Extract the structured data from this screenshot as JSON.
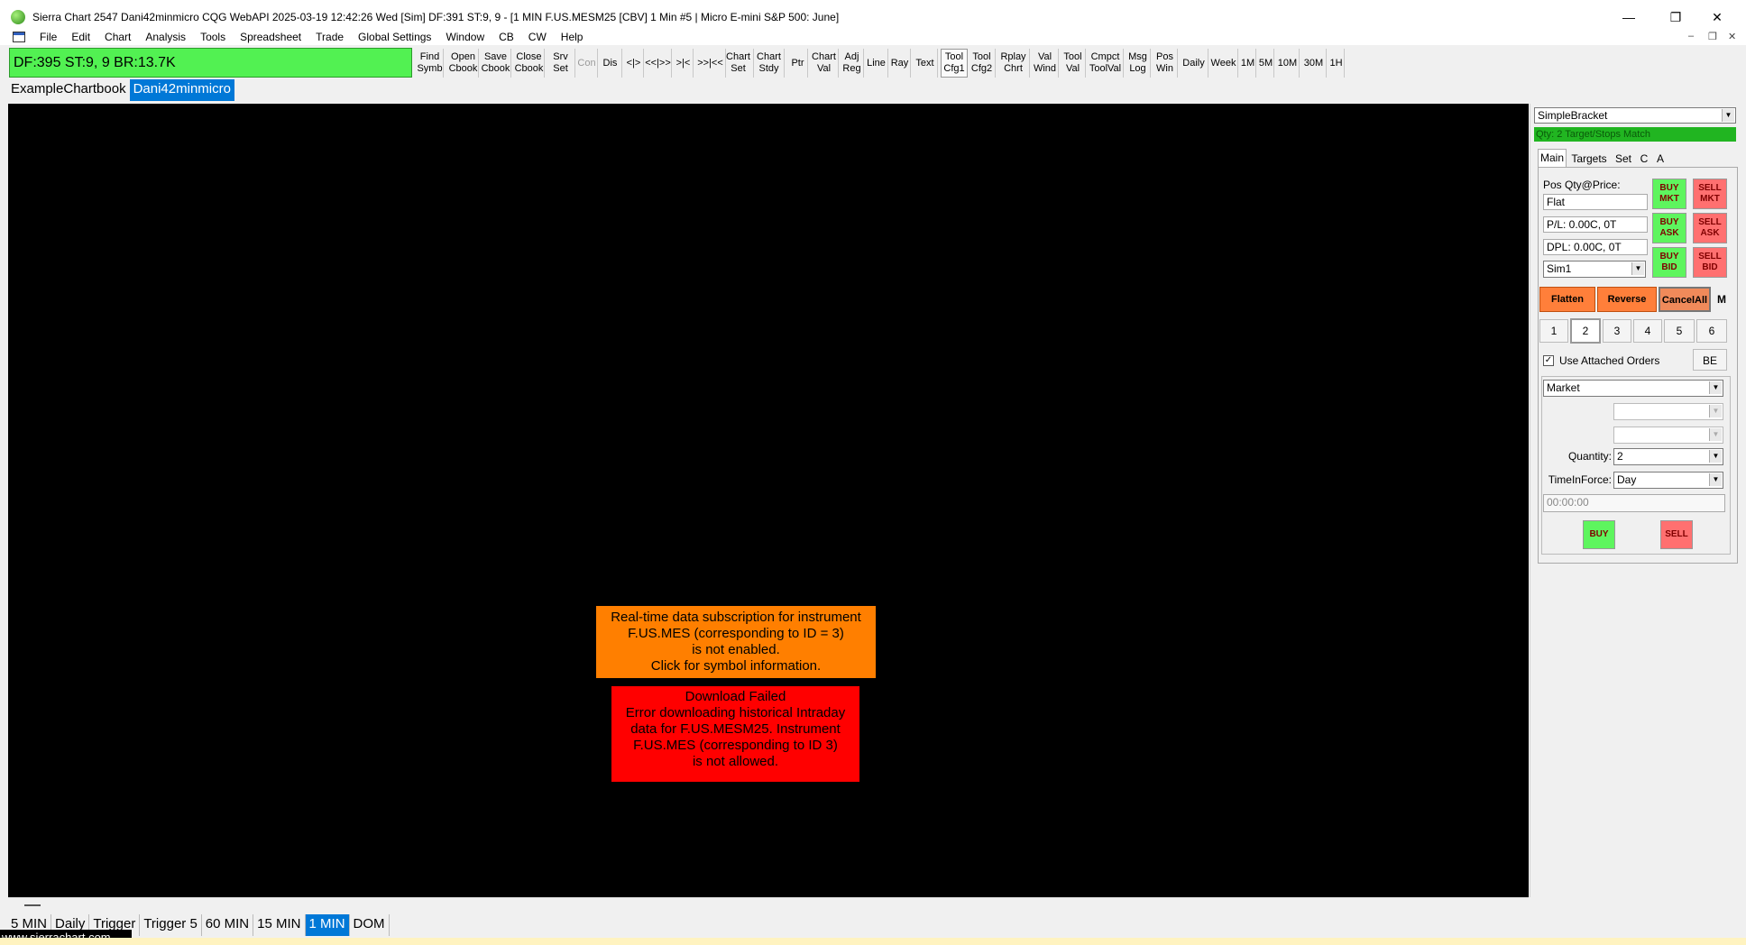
{
  "window": {
    "title": "Sierra Chart 2547 Dani42minmicro CQG WebAPI 2025-03-19  12:42:26 Wed [Sim]  DF:391  ST:9, 9 - [1 MIN F.US.MESM25 [CBV]  1 Min  #5 | Micro E-mini S&P 500: June]",
    "minimize": "—",
    "maximize": "❐",
    "close": "✕"
  },
  "menu": {
    "items": [
      "File",
      "Edit",
      "Chart",
      "Analysis",
      "Tools",
      "Spreadsheet",
      "Trade",
      "Global Settings",
      "Window",
      "CB",
      "CW",
      "Help"
    ],
    "mdi_min": "–",
    "mdi_restore": "❐",
    "mdi_close": "✕"
  },
  "toolbar": {
    "status": "DF:395  ST:9, 9  BR:13.7K",
    "buttons": [
      {
        "label": "Find\nSymb"
      },
      {
        "label": "Open\nCbook"
      },
      {
        "label": "Save\nCbook"
      },
      {
        "label": "Close\nCbook"
      },
      {
        "label": "Srv\nSet"
      },
      {
        "label": "Con",
        "disabled": true
      },
      {
        "label": "Dis"
      },
      {
        "label": "<|>"
      },
      {
        "label": "<<|>>"
      },
      {
        "label": ">|<"
      },
      {
        "label": ">>|<<"
      },
      {
        "label": "Chart\nSet"
      },
      {
        "label": "Chart\nStdy"
      },
      {
        "label": "Ptr"
      },
      {
        "label": "Chart\nVal"
      },
      {
        "label": "Adj\nReg"
      },
      {
        "label": "Line"
      },
      {
        "label": "Ray"
      },
      {
        "label": "Text"
      },
      {
        "label": "Tool\nCfg1",
        "pressed": true
      },
      {
        "label": "Tool\nCfg2"
      },
      {
        "label": "Rplay\nChrt"
      },
      {
        "label": "Val\nWind"
      },
      {
        "label": "Tool\nVal"
      },
      {
        "label": "Cmpct\nToolVal"
      },
      {
        "label": "Msg\nLog"
      },
      {
        "label": "Pos\nWin"
      },
      {
        "label": "Daily"
      },
      {
        "label": "Week"
      },
      {
        "label": "1M"
      },
      {
        "label": "5M"
      },
      {
        "label": "10M"
      },
      {
        "label": "30M"
      },
      {
        "label": "1H"
      }
    ]
  },
  "chartbooks": [
    {
      "label": "ExampleChartbook",
      "active": false
    },
    {
      "label": "Dani42minmicro",
      "active": true
    }
  ],
  "chart": {
    "messages": {
      "realtime": "Real-time data subscription for instrument\nF.US.MES (corresponding to ID = 3)\nis not enabled.\nClick for symbol information.",
      "download": "Download Failed\nError downloading historical Intraday\ndata for F.US.MESM25.  Instrument\nF.US.MES (corresponding to ID 3)\nis not allowed."
    }
  },
  "trade_panel": {
    "config": "SimpleBracket",
    "config_status": "Qty: 2 Target/Stops Match",
    "tabs": [
      "Main",
      "Targets",
      "Set",
      "C",
      "A"
    ],
    "pos_label": "Pos Qty@Price:",
    "pos_value": "Flat",
    "pl_value": "P/L: 0.00C, 0T",
    "dpl_value": "DPL: 0.00C, 0T",
    "account": "Sim1",
    "buy_mkt": "BUY\nMKT",
    "sell_mkt": "SELL\nMKT",
    "buy_ask": "BUY\nASK",
    "sell_ask": "SELL\nASK",
    "buy_bid": "BUY\nBID",
    "sell_bid": "SELL\nBID",
    "flatten": "Flatten",
    "reverse": "Reverse",
    "cancel_all": "CancelAll",
    "m": "M",
    "qty_buttons": [
      "1",
      "2",
      "3",
      "4",
      "5",
      "6"
    ],
    "use_attached": "Use Attached Orders",
    "be": "BE",
    "order_type": "Market",
    "quantity_label": "Quantity:",
    "quantity": "2",
    "tif_label": "TimeInForce:",
    "tif": "Day",
    "time": "00:00:00",
    "buy": "BUY",
    "sell": "SELL"
  },
  "bottom_tabs": [
    {
      "label": "5 MIN",
      "active": false
    },
    {
      "label": "Daily",
      "active": false
    },
    {
      "label": "Trigger",
      "active": false
    },
    {
      "label": "Trigger 5",
      "active": false
    },
    {
      "label": "60 MIN",
      "active": false
    },
    {
      "label": "15 MIN",
      "active": false
    },
    {
      "label": "1 MIN",
      "active": true
    },
    {
      "label": "DOM",
      "active": false
    }
  ],
  "website": "www.sierrachart.com",
  "colors": {
    "status_green": "#52f152",
    "accent_blue": "#0078d7",
    "msg_orange": "#ff7f00",
    "msg_red": "#ff0000"
  }
}
